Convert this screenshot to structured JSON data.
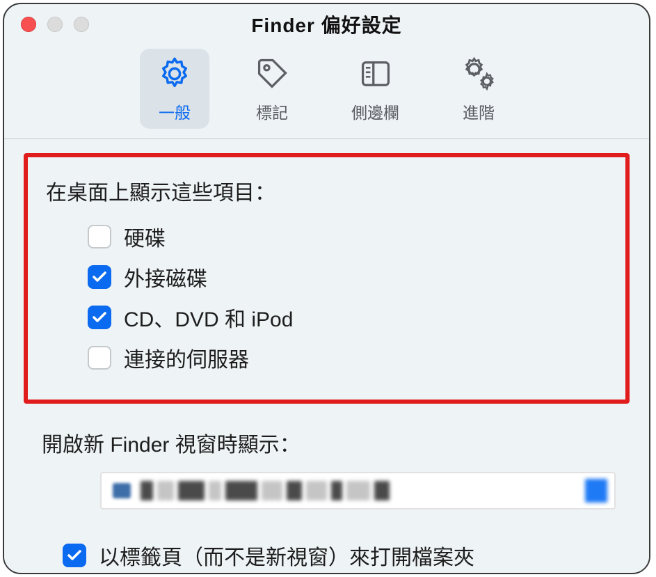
{
  "window": {
    "title": "Finder 偏好設定"
  },
  "tabs": [
    {
      "id": "general",
      "label": "一般",
      "active": true
    },
    {
      "id": "tags",
      "label": "標記",
      "active": false
    },
    {
      "id": "sidebar",
      "label": "側邊欄",
      "active": false
    },
    {
      "id": "advanced",
      "label": "進階",
      "active": false
    }
  ],
  "desktop_section": {
    "heading": "在桌面上顯示這些項目：",
    "items": [
      {
        "label": "硬碟",
        "checked": false
      },
      {
        "label": "外接磁碟",
        "checked": true
      },
      {
        "label": "CD、DVD 和 iPod",
        "checked": true
      },
      {
        "label": "連接的伺服器",
        "checked": false
      }
    ]
  },
  "new_window": {
    "heading": "開啟新 Finder 視窗時顯示：",
    "selected_value_obscured": true
  },
  "open_in_tabs": {
    "label": "以標籤頁（而不是新視窗）來打開檔案夾",
    "checked": true
  }
}
